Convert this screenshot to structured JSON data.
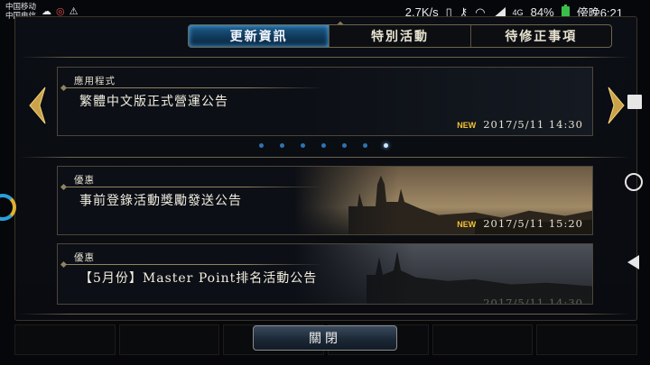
{
  "status_bar": {
    "carrier1": "中国移动",
    "carrier2": "中国电信",
    "speed": "2.7K/s",
    "network": "4G",
    "battery": "84%",
    "time": "傍晚6:21"
  },
  "tabs": [
    {
      "label": "更新資訊",
      "active": true
    },
    {
      "label": "特別活動",
      "active": false
    },
    {
      "label": "待修正事項",
      "active": false
    }
  ],
  "featured": {
    "category": "應用程式",
    "title": "繁體中文版正式營運公告",
    "badge": "NEW",
    "date": "2017/5/11 14:30"
  },
  "pager": {
    "count": 7,
    "active_index": 6
  },
  "notices": [
    {
      "category": "優惠",
      "title": "事前登錄活動獎勵發送公告",
      "badge": "NEW",
      "date": "2017/5/11 15:20"
    },
    {
      "category": "優惠",
      "title": "【5月份】Master Point排名活動公告",
      "badge": "",
      "date": "2017/5/11 14:30"
    }
  ],
  "close_button": "關閉",
  "colors": {
    "accent": "#1f5d8a",
    "new_badge": "#f2c232",
    "gold_border": "#6d654c"
  },
  "icons": [
    "arrow-left-icon",
    "arrow-right-icon",
    "wifi-icon",
    "signal-icon",
    "battery-icon"
  ]
}
